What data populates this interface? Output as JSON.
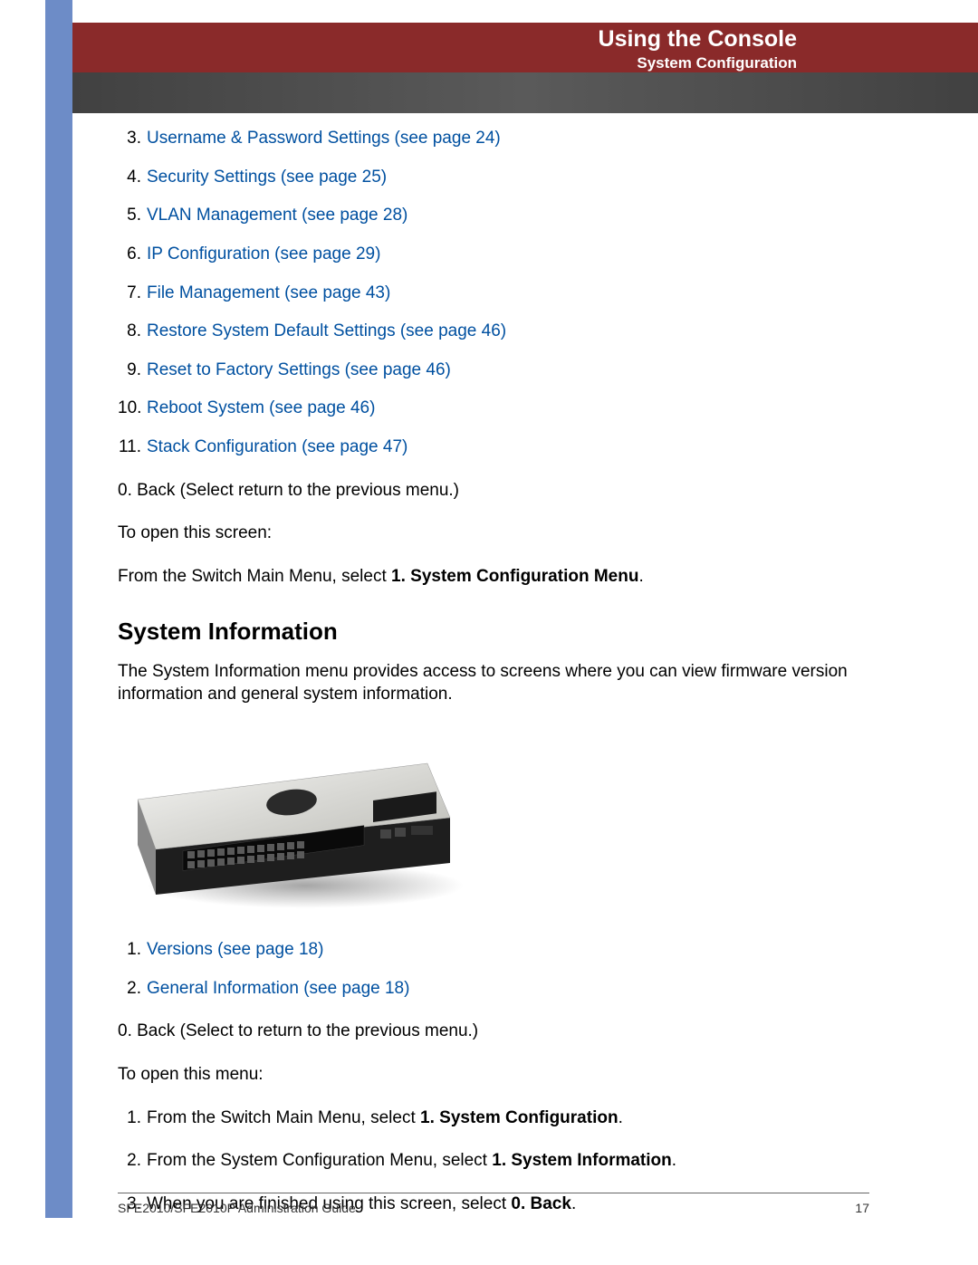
{
  "header": {
    "title": "Using the Console",
    "subtitle": "System Configuration"
  },
  "toc1": [
    {
      "num": "3.",
      "text": "Username & Password Settings (see page 24)"
    },
    {
      "num": "4.",
      "text": "Security Settings (see page 25)"
    },
    {
      "num": "5.",
      "text": "VLAN Management (see page 28)"
    },
    {
      "num": "6.",
      "text": "IP Configuration (see page 29)"
    },
    {
      "num": "7.",
      "text": "File Management (see page 43)"
    },
    {
      "num": "8.",
      "text": "Restore System Default Settings (see page 46)"
    },
    {
      "num": "9.",
      "text": "Reset to Factory Settings (see page 46)"
    },
    {
      "num": "10.",
      "text": "Reboot System (see page 46)"
    },
    {
      "num": "11.",
      "text": "Stack Configuration (see page 47)"
    }
  ],
  "back1": "0. Back (Select return to the previous menu.)",
  "to_open1": "To open this screen:",
  "from1_pre": "From the ",
  "from1_alt": "Switch Main Menu",
  "from1_mid": ", select ",
  "from1_bold": "1. System Configuration Menu",
  "from1_end": ".",
  "section": "System Information",
  "para_pre": "The ",
  "para_alt": "System Information",
  "para_rest": " menu provides access to screens where you can view firmware version information and general system information.",
  "toc2": [
    {
      "num": "1.",
      "text": "Versions (see page 18)"
    },
    {
      "num": "2.",
      "text": "General Information (see page 18)"
    }
  ],
  "back2": "0. Back (Select to return to the previous menu.)",
  "to_open2": "To open this menu:",
  "steps": [
    {
      "num": "1.",
      "pre": "From the ",
      "alt": "Switch Main Menu",
      "mid": ", select ",
      "bold": "1. System Configuration",
      "end": "."
    },
    {
      "num": "2.",
      "pre": "From the ",
      "alt": "System Configuration Menu",
      "mid": ", select ",
      "bold": "1. System Information",
      "end": "."
    },
    {
      "num": "3.",
      "pre": "When you are finished using this screen, select ",
      "alt": "",
      "mid": "",
      "bold": "0. Back",
      "end": "."
    }
  ],
  "footer": {
    "guide": "SFE2010/SFE2010P Administration Guide",
    "page": "17"
  }
}
